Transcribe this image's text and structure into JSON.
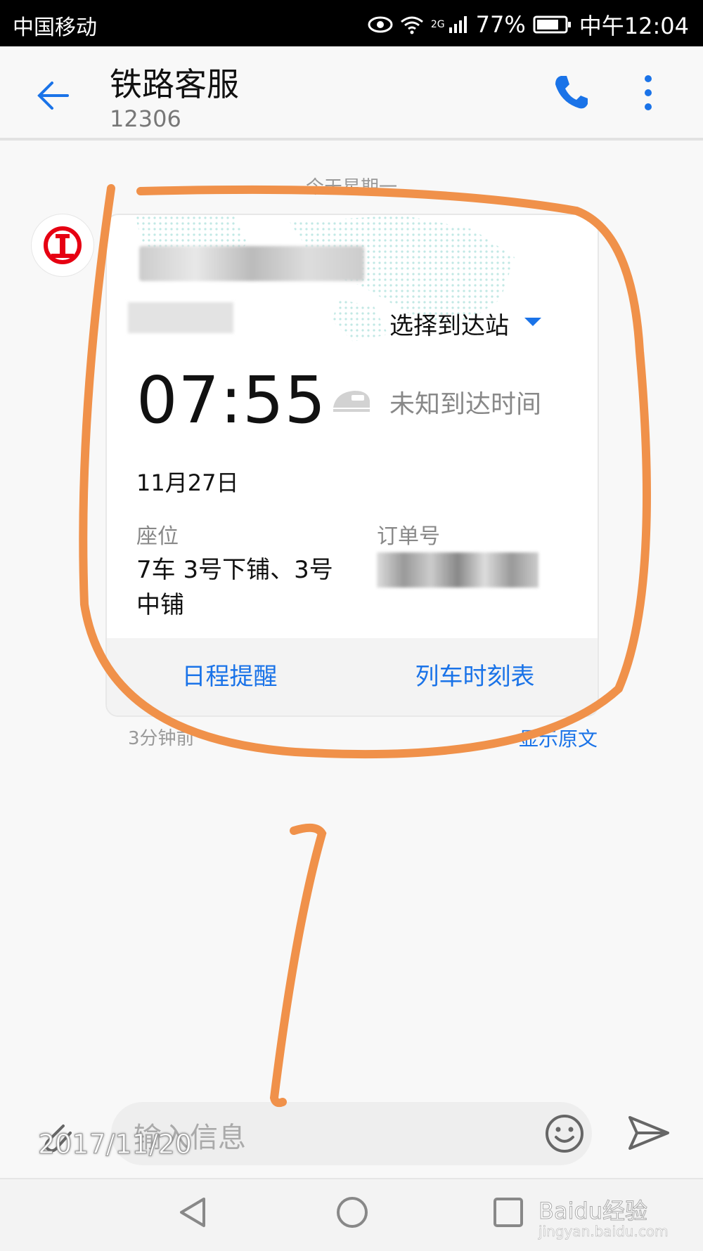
{
  "status_bar": {
    "carrier": "中国移动",
    "network": "2G",
    "battery": "77%",
    "time": "中午12:04"
  },
  "header": {
    "title": "铁路客服",
    "subtitle": "12306"
  },
  "conversation": {
    "date_separator": "今天星期一",
    "card": {
      "arrival_station_label": "选择到达站",
      "departure_time": "07:55",
      "arrival_time": "未知到达时间",
      "date": "11月27日",
      "seat_label": "座位",
      "seat_value": "7车 3号下铺、3号中铺",
      "order_label": "订单号",
      "actions": [
        "日程提醒",
        "列车时刻表"
      ]
    },
    "sent_time": "3分钟前",
    "show_original": "显示原文"
  },
  "composer": {
    "placeholder": "输入信息"
  },
  "watermark": {
    "date": "2017/11/20",
    "brand": "Baidu经验",
    "url": "jingyan.baidu.com"
  },
  "annotation": {
    "number": "1"
  },
  "colors": {
    "accent": "#1a73e8",
    "annotation": "#f0914a",
    "logo_red": "#e60012"
  }
}
